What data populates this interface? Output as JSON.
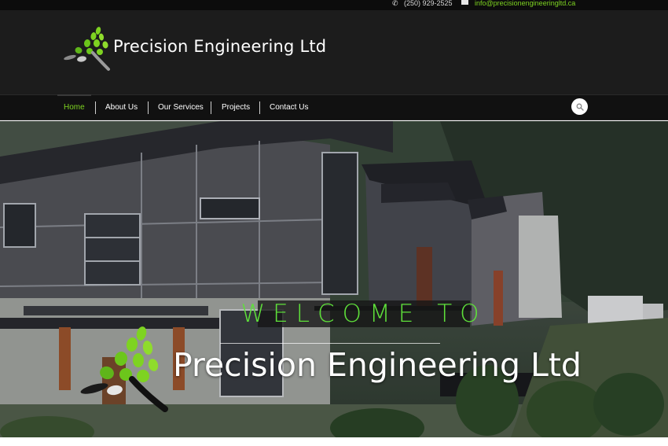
{
  "topbar": {
    "phone": "(250) 929-2525",
    "email": "info@precisionengineeringltd.ca",
    "phone_icon": "phone-icon",
    "email_icon": "envelope-icon"
  },
  "header": {
    "brand": "Precision Engineering Ltd",
    "logo_icon": "leaf-tree-logo"
  },
  "nav": {
    "items": [
      {
        "label": "Home",
        "active": true
      },
      {
        "label": "About Us",
        "active": false
      },
      {
        "label": "Our Services",
        "active": false
      },
      {
        "label": "Projects",
        "active": false
      },
      {
        "label": "Contact Us",
        "active": false
      }
    ],
    "search_icon": "search-icon"
  },
  "hero": {
    "welcome": "WELCOME TO",
    "title": "Precision Engineering Ltd"
  },
  "colors": {
    "accent": "#7ed321",
    "welcome_green": "#5ee03a",
    "header_bg": "#1c1c1c",
    "nav_bg": "#111111"
  }
}
